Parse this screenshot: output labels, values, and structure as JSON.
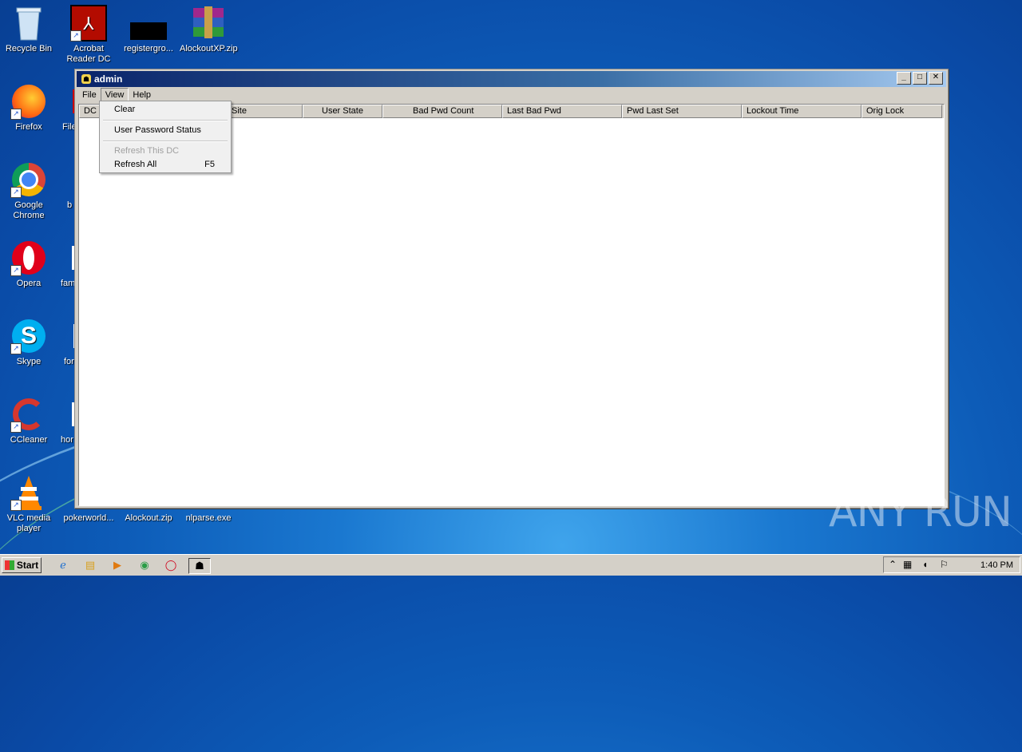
{
  "desktop": {
    "icons": [
      {
        "label": "Recycle Bin"
      },
      {
        "label": "Acrobat Reader DC"
      },
      {
        "label": "registergro..."
      },
      {
        "label": "AlockoutXP.zip"
      },
      {
        "label": "Firefox"
      },
      {
        "label": "File"
      },
      {
        "label": "Google Chrome"
      },
      {
        "label": "b"
      },
      {
        "label": "Opera"
      },
      {
        "label": "fam"
      },
      {
        "label": "Skype"
      },
      {
        "label": "for"
      },
      {
        "label": "CCleaner"
      },
      {
        "label": "hor"
      },
      {
        "label": "VLC media player"
      },
      {
        "label": "pokerworld..."
      },
      {
        "label": "Alockout.zip"
      },
      {
        "label": "nlparse.exe"
      }
    ]
  },
  "window": {
    "title": "admin",
    "buttons": {
      "minimize": "_",
      "maximize": "□",
      "close": "✕"
    },
    "menu": [
      "File",
      "View",
      "Help"
    ],
    "columns": [
      "DC N",
      "Site",
      "User State",
      "Bad Pwd Count",
      "Last Bad Pwd",
      "Pwd Last Set",
      "Lockout Time",
      "Orig Lock"
    ]
  },
  "view_menu": {
    "items": [
      {
        "label": "Clear",
        "accel": "",
        "disabled": false
      },
      {
        "label": "User Password Status",
        "accel": "",
        "disabled": false
      },
      {
        "label": "Refresh This DC",
        "accel": "",
        "disabled": true
      },
      {
        "label": "Refresh All",
        "accel": "F5",
        "disabled": false
      }
    ]
  },
  "taskbar": {
    "start_label": "Start",
    "clock": "1:40 PM"
  },
  "watermark": "ANY RUN"
}
